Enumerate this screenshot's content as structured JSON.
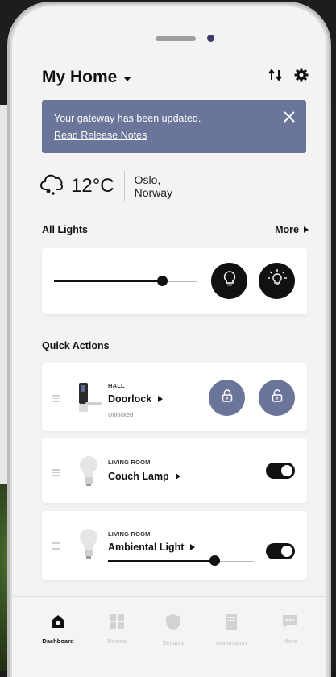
{
  "header": {
    "title": "My Home"
  },
  "banner": {
    "message": "Your gateway has been updated.",
    "link": "Read Release Notes"
  },
  "weather": {
    "temperature": "12°C",
    "city": "Oslo,",
    "country": "Norway"
  },
  "lights": {
    "section_title": "All Lights",
    "more_label": "More",
    "brightness": 0.75
  },
  "quick_actions": {
    "section_title": "Quick Actions",
    "items": [
      {
        "room": "HALL",
        "name": "Doorlock",
        "status": "Unlocked"
      },
      {
        "room": "LIVING ROOM",
        "name": "Couch Lamp",
        "toggle_on": true
      },
      {
        "room": "LIVING ROOM",
        "name": "Ambiental Light",
        "toggle_on": true,
        "brightness": 0.73
      }
    ]
  },
  "tabs": [
    {
      "label": "Dashboard",
      "icon": "home-icon",
      "active": true
    },
    {
      "label": "Rooms",
      "icon": "grid-icon",
      "active": false
    },
    {
      "label": "Security",
      "icon": "shield-icon",
      "active": false
    },
    {
      "label": "Automation",
      "icon": "phone-device-icon",
      "active": false
    },
    {
      "label": "More",
      "icon": "chat-icon",
      "active": false
    }
  ],
  "colors": {
    "accent": "#6a7599",
    "background": "#f3f3f3",
    "dark": "#111111"
  }
}
